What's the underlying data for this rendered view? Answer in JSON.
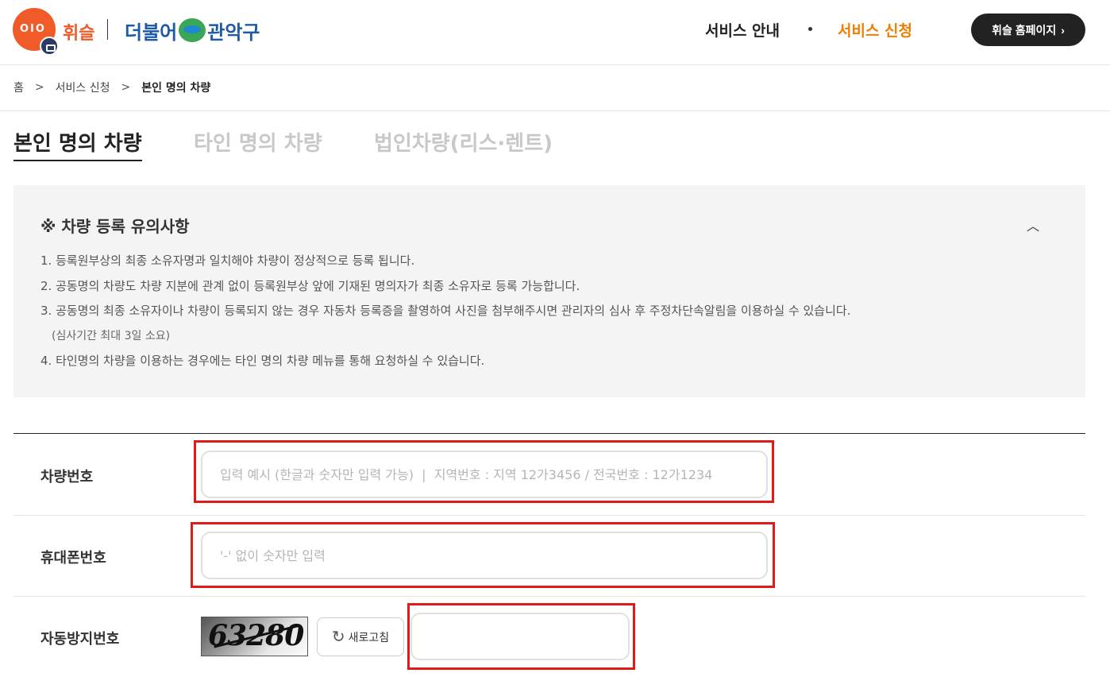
{
  "header": {
    "logo_icon_text": "OIO",
    "logo_text": "휘슬",
    "logo2_left": "더불어",
    "logo2_right": "관악구",
    "nav": [
      "서비스 안내",
      "서비스 신청"
    ],
    "home_button": "휘슬 홈페이지",
    "accent_color": "#f07d00",
    "brand_color": "#f15a29"
  },
  "breadcrumb": [
    "홈",
    "서비스 신청",
    "본인 명의 차량"
  ],
  "tabs": [
    {
      "label": "본인 명의 차량",
      "active": true
    },
    {
      "label": "타인 명의 차량",
      "active": false
    },
    {
      "label": "법인차량(리스·렌트)",
      "active": false
    }
  ],
  "notice": {
    "title": "※ 차량 등록 유의사항",
    "items": [
      "1. 등록원부상의 최종 소유자명과 일치해야 차량이 정상적으로 등록 됩니다.",
      "2. 공동명의 차량도 차량 지분에 관계 없이 등록원부상 앞에 기재된 명의자가 최종 소유자로 등록 가능합니다.",
      "3. 공동명의 최종 소유자이나 차량이 등록되지 않는 경우 자동차 등록증을 촬영하여 사진을 첨부해주시면 관리자의 심사 후 주정차단속알림을 이용하실 수 있습니다.",
      "(심사기간 최대 3일 소요)",
      "4. 타인명의 차량을 이용하는 경우에는 타인 명의 차량 메뉴를 통해 요청하실 수 있습니다."
    ]
  },
  "form": {
    "vehicle_label": "차량번호",
    "vehicle_placeholder": "입력 예시 (한글과 숫자만 입력 가능)  |  지역번호 : 지역 12가3456 / 전국번호 : 12가1234",
    "vehicle_value": "",
    "phone_label": "휴대폰번호",
    "phone_placeholder": "'-' 없이 숫자만 입력",
    "phone_value": "",
    "captcha_label": "자동방지번호",
    "captcha_code": "63280",
    "refresh_label": "새로고침",
    "captcha_value": "",
    "highlight_color": "#e01919"
  }
}
